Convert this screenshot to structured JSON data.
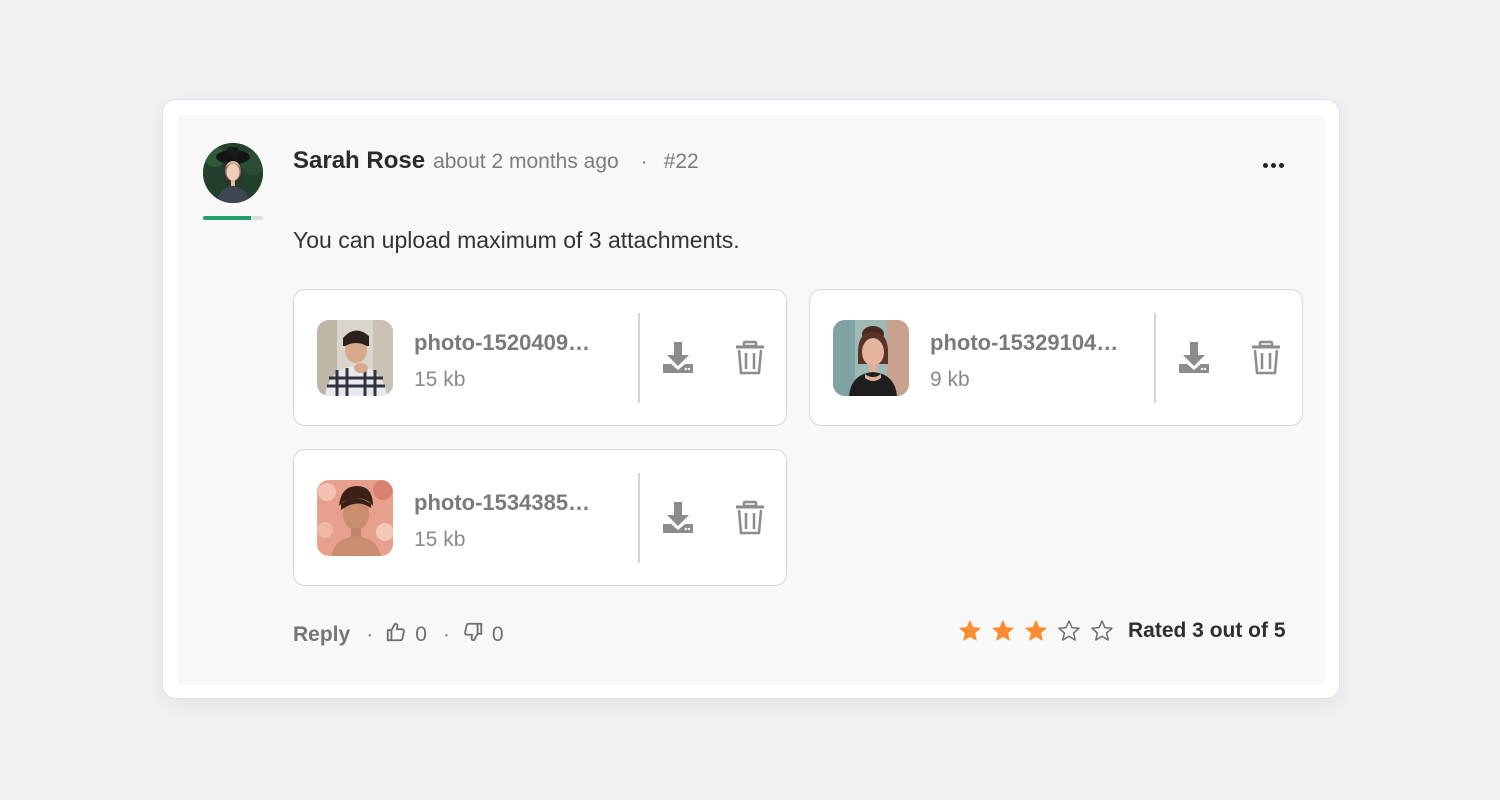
{
  "comment": {
    "author": "Sarah Rose",
    "time": "about 2 months ago",
    "separator": "·",
    "number": "#22",
    "avatar_progress": 0.8,
    "message": "You can upload maximum of 3 attachments."
  },
  "attachments": [
    {
      "name": "photo-1520409…",
      "size": "15 kb"
    },
    {
      "name": "photo-15329104…",
      "size": "9 kb"
    },
    {
      "name": "photo-1534385…",
      "size": "15 kb"
    }
  ],
  "footer": {
    "reply_label": "Reply",
    "dot": "·",
    "likes": "0",
    "dislikes": "0"
  },
  "rating": {
    "value": 3,
    "max": 5,
    "label": "Rated 3 out of 5",
    "filled_color": "#f98d2f",
    "empty_color": "#6f6f6f"
  },
  "colors": {
    "accent_green": "#22a06b",
    "background": "#f1f1f5"
  },
  "icons": {
    "more": "more-horizontal-icon",
    "download": "download-icon",
    "delete": "trash-icon",
    "like": "thumbs-up-icon",
    "dislike": "thumbs-down-icon",
    "star": "star-icon"
  }
}
